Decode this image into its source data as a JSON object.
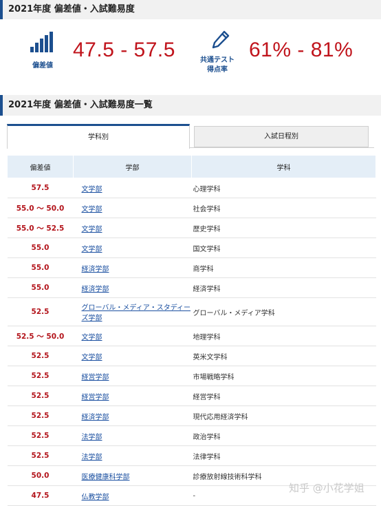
{
  "section1_title": "2021年度 偏差値・入試難易度",
  "summary": {
    "hensachi_label": "偏差値",
    "hensachi_value": "47.5 - 57.5",
    "rate_label_line1": "共通テスト",
    "rate_label_line2": "得点率",
    "rate_value": "61% - 81%"
  },
  "section2_title": "2021年度 偏差値・入試難易度一覧",
  "tabs": [
    "学科別",
    "入試日程別"
  ],
  "table": {
    "headers": [
      "偏差値",
      "学部",
      "学科"
    ],
    "rows": [
      {
        "dev": "57.5",
        "faculty": "文学部",
        "dept": "心理学科"
      },
      {
        "dev": "55.0 ～ 50.0",
        "faculty": "文学部",
        "dept": "社会学科"
      },
      {
        "dev": "55.0 ～ 52.5",
        "faculty": "文学部",
        "dept": "歴史学科"
      },
      {
        "dev": "55.0",
        "faculty": "文学部",
        "dept": "国文学科"
      },
      {
        "dev": "55.0",
        "faculty": "経済学部",
        "dept": "商学科"
      },
      {
        "dev": "55.0",
        "faculty": "経済学部",
        "dept": "経済学科"
      },
      {
        "dev": "52.5",
        "faculty": "グローバル・メディア・スタディーズ学部",
        "dept": "グローバル・メディア学科"
      },
      {
        "dev": "52.5 ～ 50.0",
        "faculty": "文学部",
        "dept": "地理学科"
      },
      {
        "dev": "52.5",
        "faculty": "文学部",
        "dept": "英米文学科"
      },
      {
        "dev": "52.5",
        "faculty": "経営学部",
        "dept": "市場戦略学科"
      },
      {
        "dev": "52.5",
        "faculty": "経営学部",
        "dept": "経営学科"
      },
      {
        "dev": "52.5",
        "faculty": "経済学部",
        "dept": "現代応用経済学科"
      },
      {
        "dev": "52.5",
        "faculty": "法学部",
        "dept": "政治学科"
      },
      {
        "dev": "52.5",
        "faculty": "法学部",
        "dept": "法律学科"
      },
      {
        "dev": "50.0",
        "faculty": "医療健康科学部",
        "dept": "診療放射線技術科学科"
      },
      {
        "dev": "47.5",
        "faculty": "仏教学部",
        "dept": "-"
      }
    ]
  },
  "watermark": "知乎 @小花学姐",
  "colors": {
    "accent": "#1c4f8f",
    "value_red": "#c0141c",
    "link": "#1a4fa0"
  },
  "icons": {
    "hensachi": "bar-chart-icon",
    "rate": "pencil-icon"
  }
}
